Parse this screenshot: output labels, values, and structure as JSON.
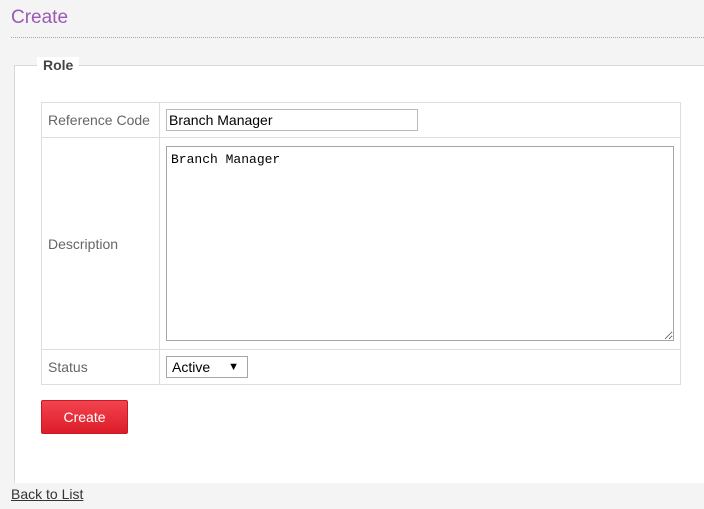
{
  "page": {
    "title": "Create"
  },
  "form": {
    "legend": "Role",
    "fields": {
      "reference_code": {
        "label": "Reference Code",
        "value": "Branch Manager"
      },
      "description": {
        "label": "Description",
        "value": "Branch Manager"
      },
      "status": {
        "label": "Status",
        "selected": "Active"
      }
    },
    "submit_label": "Create"
  },
  "footer": {
    "back_link": "Back to List"
  },
  "colors": {
    "title": "#9b59b6",
    "button": "#e52d38"
  },
  "icons": {
    "status_dropdown": "caret-down-icon",
    "textarea_resize": "resize-grip-icon"
  }
}
